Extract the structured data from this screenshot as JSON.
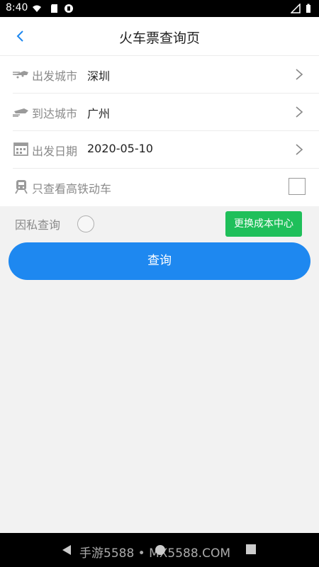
{
  "status_bar": {
    "time": "8:40"
  },
  "header": {
    "title": "火车票查询页"
  },
  "form": {
    "rows": [
      {
        "icon": "train-depart-icon",
        "label": "出发城市",
        "value": "深圳"
      },
      {
        "icon": "train-arrive-icon",
        "label": "到达城市",
        "value": "广州"
      },
      {
        "icon": "calendar-icon",
        "label": "出发日期",
        "value": "2020-05-10"
      },
      {
        "icon": "high-speed-train-icon",
        "label": "只查看高铁动车"
      }
    ]
  },
  "private_query": {
    "label": "因私查询"
  },
  "cost_center_button": {
    "label": "更换成本中心"
  },
  "query_button": {
    "label": "查询"
  },
  "watermark": {
    "text": "手游5588 • MX5588.COM"
  },
  "colors": {
    "primary": "#1e88f0",
    "success": "#1fbf5a",
    "background": "#f2f2f2"
  }
}
